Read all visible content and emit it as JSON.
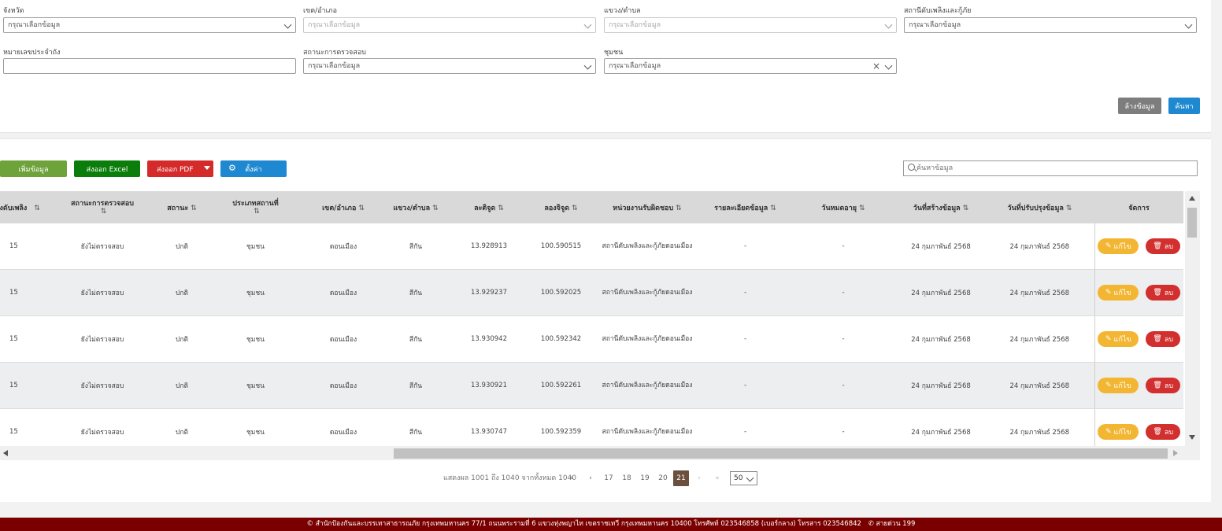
{
  "filters": {
    "province": {
      "label": "จังหวัด",
      "value": "กรุณาเลือกข้อมูล"
    },
    "district": {
      "label": "เขต/อำเภอ",
      "value": "กรุณาเลือกข้อมูล"
    },
    "subdistrict": {
      "label": "แขวง/ตำบล",
      "value": "กรุณาเลือกข้อมูล"
    },
    "station": {
      "label": "สถานีดับเพลิงและกู้ภัย",
      "value": "กรุณาเลือกข้อมูล"
    },
    "tank_number": {
      "label": "หมายเลขประจำถัง",
      "value": ""
    },
    "inspection_status": {
      "label": "สถานะการตรวจสอบ",
      "value": "กรุณาเลือกข้อมูล"
    },
    "community": {
      "label": "ชุมชน",
      "value": "กรุณาเลือกข้อมูล"
    }
  },
  "actions": {
    "clear": "ล้างข้อมูล",
    "search": "ค้นหา"
  },
  "toolbar": {
    "add": "เพิ่มข้อมูล",
    "excel": "ส่งออก Excel",
    "pdf": "ส่งออก PDF",
    "settings": "ตั้งค่า"
  },
  "table_search": {
    "placeholder": "ค้นหาข้อมูล"
  },
  "table": {
    "columns": [
      "ถังดับเพลิง",
      "สถานะการตรวจสอบ",
      "สถานะ",
      "ประเภทสถานที่",
      "เขต/อำเภอ",
      "แขวง/ตำบล",
      "ละติจูด",
      "ลองจิจูด",
      "หน่วยงานรับผิดชอบ",
      "รายละเอียดข้อมูล",
      "วันหมดอายุ",
      "วันที่สร้างข้อมูล",
      "วันที่ปรับปรุงข้อมูล",
      "จัดการ"
    ],
    "rows": [
      [
        "15",
        "ยังไม่ตรวจสอบ",
        "ปกติ",
        "ชุมชน",
        "ดอนเมือง",
        "สีกัน",
        "13.928913",
        "100.590515",
        "สถานีดับเพลิงและกู้ภัยดอนเมือง",
        "-",
        "-",
        "24 กุมภาพันธ์ 2568",
        "24 กุมภาพันธ์ 2568"
      ],
      [
        "15",
        "ยังไม่ตรวจสอบ",
        "ปกติ",
        "ชุมชน",
        "ดอนเมือง",
        "สีกัน",
        "13.929237",
        "100.592025",
        "สถานีดับเพลิงและกู้ภัยดอนเมือง",
        "-",
        "-",
        "24 กุมภาพันธ์ 2568",
        "24 กุมภาพันธ์ 2568"
      ],
      [
        "15",
        "ยังไม่ตรวจสอบ",
        "ปกติ",
        "ชุมชน",
        "ดอนเมือง",
        "สีกัน",
        "13.930942",
        "100.592342",
        "สถานีดับเพลิงและกู้ภัยดอนเมือง",
        "-",
        "-",
        "24 กุมภาพันธ์ 2568",
        "24 กุมภาพันธ์ 2568"
      ],
      [
        "15",
        "ยังไม่ตรวจสอบ",
        "ปกติ",
        "ชุมชน",
        "ดอนเมือง",
        "สีกัน",
        "13.930921",
        "100.592261",
        "สถานีดับเพลิงและกู้ภัยดอนเมือง",
        "-",
        "-",
        "24 กุมภาพันธ์ 2568",
        "24 กุมภาพันธ์ 2568"
      ],
      [
        "15",
        "ยังไม่ตรวจสอบ",
        "ปกติ",
        "ชุมชน",
        "ดอนเมือง",
        "สีกัน",
        "13.930747",
        "100.592359",
        "สถานีดับเพลิงและกู้ภัยดอนเมือง",
        "-",
        "-",
        "24 กุมภาพันธ์ 2568",
        "24 กุมภาพันธ์ 2568"
      ]
    ],
    "edit_label": "แก้ไข",
    "delete_label": "ลบ"
  },
  "pagination": {
    "summary": "แสดงผล 1001 ถึง 1040 จากทั้งหมด 1040",
    "pages": [
      "17",
      "18",
      "19",
      "20",
      "21"
    ],
    "current": "21",
    "page_size": "50"
  },
  "footer": {
    "text": "© สำนักป้องกันและบรรเทาสาธารณภัย กรุงเทพมหานคร 77/1 ถนนพระรามที่ 6 แขวงทุ่งพญาไท เขตราชเทวี กรุงเทพมหานคร 10400 โทรศัพท์ 023546858 (เบอร์กลาง) โทรสาร 023546842",
    "hotline": "สายด่วน 199"
  },
  "colors": {
    "add": "#6ea23a",
    "excel": "#0a7d0a",
    "pdf": "#d42a2a",
    "settings": "#1e88d0",
    "clear": "#7d7d7d",
    "search": "#1e88d0",
    "edit": "#f2b632",
    "delete": "#d22f2f",
    "active_page": "#6b4f3f",
    "footer": "#7a0000"
  }
}
